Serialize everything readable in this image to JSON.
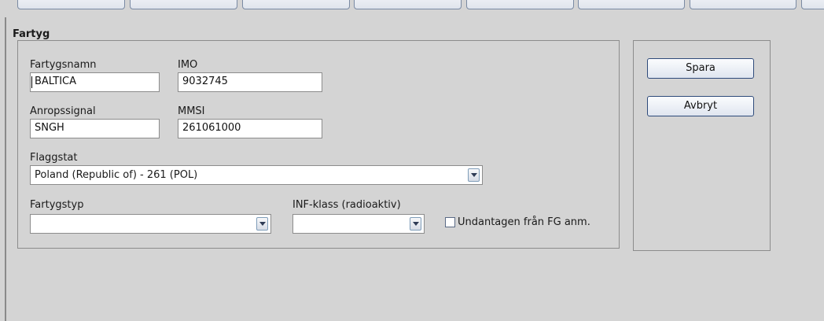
{
  "section": {
    "title": "Fartyg"
  },
  "fields": {
    "vessel_name": {
      "label": "Fartygsnamn",
      "value": "BALTICA"
    },
    "imo": {
      "label": "IMO",
      "value": "9032745"
    },
    "call_sign": {
      "label": "Anropssignal",
      "value": "SNGH"
    },
    "mmsi": {
      "label": "MMSI",
      "value": "261061000"
    },
    "flag_state": {
      "label": "Flaggstat",
      "value": "Poland (Republic of) - 261 (POL)"
    },
    "vessel_type": {
      "label": "Fartygstyp",
      "value": ""
    },
    "inf_class": {
      "label": "INF-klass (radioaktiv)",
      "value": ""
    },
    "exempt": {
      "label": "Undantagen från FG anm.",
      "checked": false
    }
  },
  "buttons": {
    "save": "Spara",
    "cancel": "Avbryt"
  },
  "icons": {
    "dropdown": "chevron-down-icon"
  }
}
